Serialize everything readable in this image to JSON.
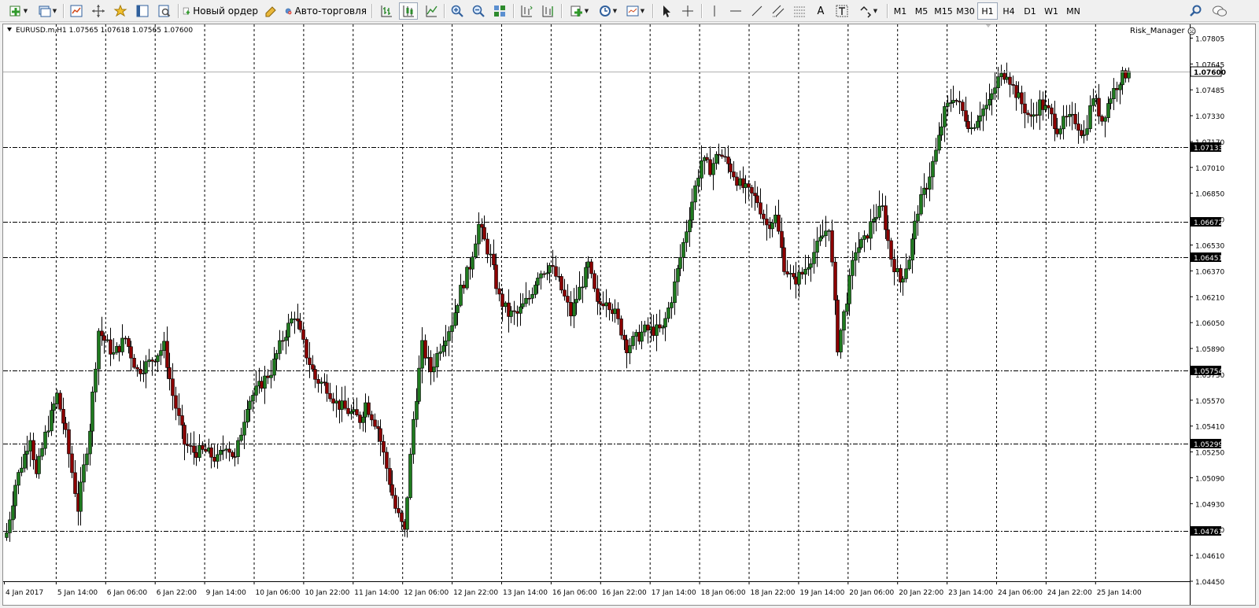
{
  "toolbar": {
    "new_order_label": "Новый ордер",
    "auto_trading_label": "Авто-торговля",
    "timeframes": [
      "M1",
      "M5",
      "M15",
      "M30",
      "H1",
      "H4",
      "D1",
      "W1",
      "MN"
    ],
    "active_timeframe": "H1"
  },
  "chart": {
    "symbol_info": "EURUSD.m,H1  1.07565 1.07618 1.07565 1.07600",
    "expert_label": "Risk_Manager",
    "current_price": "1.07600"
  },
  "chart_data": {
    "type": "candlestick",
    "symbol": "EURUSD.m",
    "timeframe": "H1",
    "last_bar": {
      "open": 1.07565,
      "high": 1.07618,
      "low": 1.07565,
      "close": 1.076
    },
    "ylim": [
      1.0445,
      1.0788
    ],
    "y_ticks": [
      "1.07805",
      "1.07645",
      "1.07485",
      "1.07330",
      "1.07170",
      "1.07010",
      "1.06850",
      "1.06690",
      "1.06530",
      "1.06370",
      "1.06210",
      "1.06050",
      "1.05890",
      "1.05730",
      "1.05570",
      "1.05410",
      "1.05250",
      "1.05090",
      "1.04930",
      "1.04770",
      "1.04610",
      "1.04450"
    ],
    "x_ticks": [
      "4 Jan 2017",
      "5 Jan 14:00",
      "6 Jan 06:00",
      "6 Jan 22:00",
      "9 Jan 14:00",
      "10 Jan 06:00",
      "10 Jan 22:00",
      "11 Jan 14:00",
      "12 Jan 06:00",
      "12 Jan 22:00",
      "13 Jan 14:00",
      "16 Jan 06:00",
      "16 Jan 22:00",
      "17 Jan 14:00",
      "18 Jan 06:00",
      "18 Jan 22:00",
      "19 Jan 14:00",
      "20 Jan 06:00",
      "20 Jan 22:00",
      "23 Jan 14:00",
      "24 Jan 06:00",
      "24 Jan 22:00",
      "25 Jan 14:00"
    ],
    "horizontal_levels": [
      {
        "price": 1.07133,
        "label": "1.07133"
      },
      {
        "price": 1.06672,
        "label": "1.06672"
      },
      {
        "price": 1.06451,
        "label": "1.06451"
      },
      {
        "price": 1.05754,
        "label": "1.05754"
      },
      {
        "price": 1.05299,
        "label": "1.05299"
      },
      {
        "price": 1.04761,
        "label": "1.04761"
      }
    ],
    "close_path": [
      [
        0,
        1.0475
      ],
      [
        3,
        1.0505
      ],
      [
        8,
        1.0535
      ],
      [
        10,
        1.051
      ],
      [
        13,
        1.0535
      ],
      [
        17,
        1.056
      ],
      [
        20,
        1.0535
      ],
      [
        24,
        1.049
      ],
      [
        28,
        1.054
      ],
      [
        31,
        1.06
      ],
      [
        36,
        1.0585
      ],
      [
        40,
        1.0595
      ],
      [
        44,
        1.0575
      ],
      [
        48,
        1.058
      ],
      [
        53,
        1.059
      ],
      [
        56,
        1.056
      ],
      [
        60,
        1.053
      ],
      [
        63,
        1.0525
      ],
      [
        67,
        1.0525
      ],
      [
        71,
        1.052
      ],
      [
        74,
        1.053
      ],
      [
        77,
        1.052
      ],
      [
        81,
        1.0555
      ],
      [
        85,
        1.0565
      ],
      [
        89,
        1.0575
      ],
      [
        93,
        1.0595
      ],
      [
        97,
        1.061
      ],
      [
        101,
        1.0585
      ],
      [
        104,
        1.057
      ],
      [
        108,
        1.0565
      ],
      [
        111,
        1.0555
      ],
      [
        115,
        1.055
      ],
      [
        119,
        1.0545
      ],
      [
        121,
        1.0555
      ],
      [
        125,
        1.054
      ],
      [
        128,
        1.0515
      ],
      [
        131,
        1.049
      ],
      [
        134,
        1.0475
      ],
      [
        137,
        1.0545
      ],
      [
        140,
        1.059
      ],
      [
        143,
        1.0575
      ],
      [
        146,
        1.059
      ],
      [
        150,
        1.0605
      ],
      [
        153,
        1.0625
      ],
      [
        156,
        1.064
      ],
      [
        159,
        1.0665
      ],
      [
        163,
        1.0645
      ],
      [
        166,
        1.062
      ],
      [
        169,
        1.061
      ],
      [
        172,
        1.061
      ],
      [
        176,
        1.062
      ],
      [
        179,
        1.0635
      ],
      [
        183,
        1.064
      ],
      [
        186,
        1.063
      ],
      [
        190,
        1.061
      ],
      [
        193,
        1.0625
      ],
      [
        196,
        1.064
      ],
      [
        199,
        1.0615
      ],
      [
        202,
        1.062
      ],
      [
        205,
        1.061
      ],
      [
        209,
        1.059
      ],
      [
        212,
        1.0595
      ],
      [
        215,
        1.06
      ],
      [
        218,
        1.06
      ],
      [
        221,
        1.06
      ],
      [
        224,
        1.062
      ],
      [
        227,
        1.0645
      ],
      [
        231,
        1.068
      ],
      [
        234,
        1.0705
      ],
      [
        237,
        1.07
      ],
      [
        240,
        1.071
      ],
      [
        244,
        1.07
      ],
      [
        247,
        1.069
      ],
      [
        250,
        1.0685
      ],
      [
        253,
        1.068
      ],
      [
        256,
        1.0665
      ],
      [
        259,
        1.067
      ],
      [
        262,
        1.064
      ],
      [
        265,
        1.063
      ],
      [
        268,
        1.0635
      ],
      [
        271,
        1.0645
      ],
      [
        274,
        1.0655
      ],
      [
        277,
        1.0665
      ],
      [
        280,
        1.059
      ],
      [
        283,
        1.062
      ],
      [
        286,
        1.065
      ],
      [
        289,
        1.0655
      ],
      [
        292,
        1.067
      ],
      [
        295,
        1.0675
      ],
      [
        298,
        1.0645
      ],
      [
        301,
        1.063
      ],
      [
        304,
        1.0645
      ],
      [
        307,
        1.0675
      ],
      [
        310,
        1.069
      ],
      [
        313,
        1.071
      ],
      [
        316,
        1.0735
      ],
      [
        319,
        1.0745
      ],
      [
        322,
        1.0735
      ],
      [
        325,
        1.0725
      ],
      [
        328,
        1.0735
      ],
      [
        331,
        1.074
      ],
      [
        334,
        1.0755
      ],
      [
        337,
        1.076
      ],
      [
        339,
        1.075
      ],
      [
        342,
        1.074
      ],
      [
        345,
        1.073
      ],
      [
        348,
        1.074
      ],
      [
        351,
        1.0735
      ],
      [
        354,
        1.0725
      ],
      [
        357,
        1.073
      ],
      [
        360,
        1.073
      ],
      [
        363,
        1.072
      ],
      [
        366,
        1.0745
      ],
      [
        369,
        1.073
      ],
      [
        372,
        1.0745
      ],
      [
        375,
        1.0755
      ],
      [
        378,
        1.076
      ]
    ]
  }
}
